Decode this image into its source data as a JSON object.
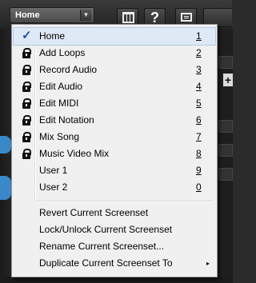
{
  "toolbar": {
    "screenset_combo": "Home",
    "help_label": "?"
  },
  "menu": {
    "items": [
      {
        "label": "Home",
        "key": "1",
        "icon": "check-icon"
      },
      {
        "label": "Add Loops",
        "key": "2",
        "icon": "lock-icon"
      },
      {
        "label": "Record Audio",
        "key": "3",
        "icon": "lock-icon"
      },
      {
        "label": "Edit Audio",
        "key": "4",
        "icon": "lock-icon"
      },
      {
        "label": "Edit MIDI",
        "key": "5",
        "icon": "lock-icon"
      },
      {
        "label": "Edit Notation",
        "key": "6",
        "icon": "lock-icon"
      },
      {
        "label": "Mix Song",
        "key": "7",
        "icon": "lock-icon"
      },
      {
        "label": "Music Video Mix",
        "key": "8",
        "icon": "lock-icon"
      },
      {
        "label": "User 1",
        "key": "9",
        "icon": ""
      },
      {
        "label": "User 2",
        "key": "0",
        "icon": ""
      }
    ],
    "actions": [
      {
        "label": "Revert Current Screenset"
      },
      {
        "label": "Lock/Unlock Current Screenset"
      },
      {
        "label": "Rename Current Screenset..."
      },
      {
        "label": "Duplicate Current Screenset To",
        "submenu_arrow": "▸"
      }
    ]
  },
  "side": {
    "plus_label": "+"
  }
}
